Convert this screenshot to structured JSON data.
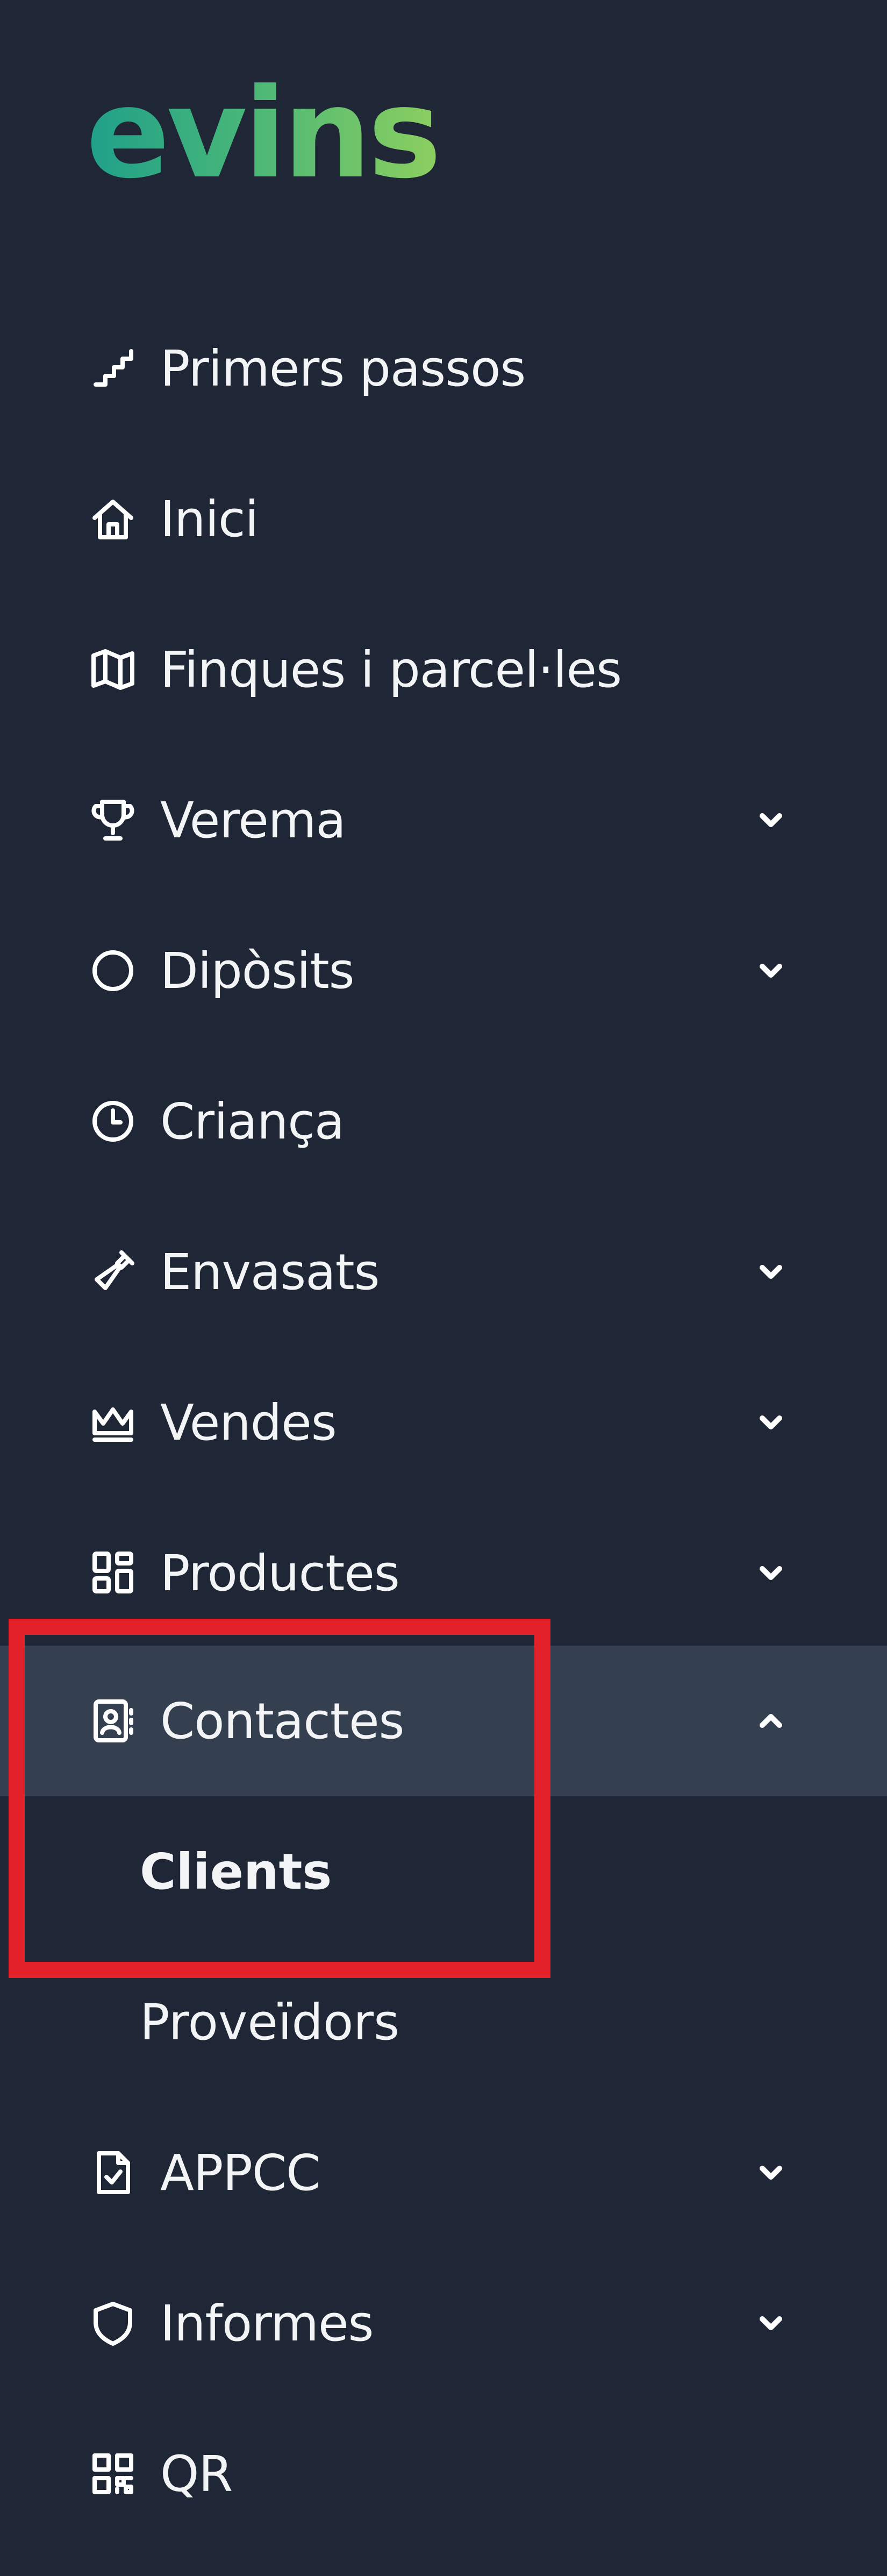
{
  "brand": {
    "logo_text": "evins"
  },
  "nav": {
    "items": [
      {
        "id": "primers",
        "label": "Primers passos",
        "icon": "stairs-icon",
        "has_chevron": false
      },
      {
        "id": "inici",
        "label": "Inici",
        "icon": "home-icon",
        "has_chevron": false
      },
      {
        "id": "finques",
        "label": "Finques i parcel·les",
        "icon": "map-icon",
        "has_chevron": false
      },
      {
        "id": "verema",
        "label": "Verema",
        "icon": "trophy-icon",
        "has_chevron": true,
        "chevron": "down"
      },
      {
        "id": "diposits",
        "label": "Dipòsits",
        "icon": "circle-icon",
        "has_chevron": true,
        "chevron": "down"
      },
      {
        "id": "crianca",
        "label": "Criança",
        "icon": "clock-icon",
        "has_chevron": false
      },
      {
        "id": "envasats",
        "label": "Envasats",
        "icon": "bottle-icon",
        "has_chevron": true,
        "chevron": "down"
      },
      {
        "id": "vendes",
        "label": "Vendes",
        "icon": "crown-icon",
        "has_chevron": true,
        "chevron": "down"
      },
      {
        "id": "productes",
        "label": "Productes",
        "icon": "grid-icon",
        "has_chevron": true,
        "chevron": "down"
      },
      {
        "id": "contactes",
        "label": "Contactes",
        "icon": "contacts-icon",
        "has_chevron": true,
        "chevron": "up",
        "expanded": true
      },
      {
        "id": "appcc",
        "label": "APPCC",
        "icon": "document-check-icon",
        "has_chevron": true,
        "chevron": "down"
      },
      {
        "id": "informes",
        "label": "Informes",
        "icon": "shield-icon",
        "has_chevron": true,
        "chevron": "down"
      },
      {
        "id": "qr",
        "label": "QR",
        "icon": "qr-code-icon",
        "has_chevron": false
      }
    ],
    "contactes_children": [
      {
        "id": "clients",
        "label": "Clients",
        "current": true
      },
      {
        "id": "proveidors",
        "label": "Proveïdors",
        "current": false
      }
    ]
  },
  "colors": {
    "background": "#1f2736",
    "active_row": "#343f50",
    "text": "#f3f4f6",
    "highlight": "#e3212b",
    "logo_gradient_start": "#1fa08a",
    "logo_gradient_end": "#8ccf5f"
  }
}
